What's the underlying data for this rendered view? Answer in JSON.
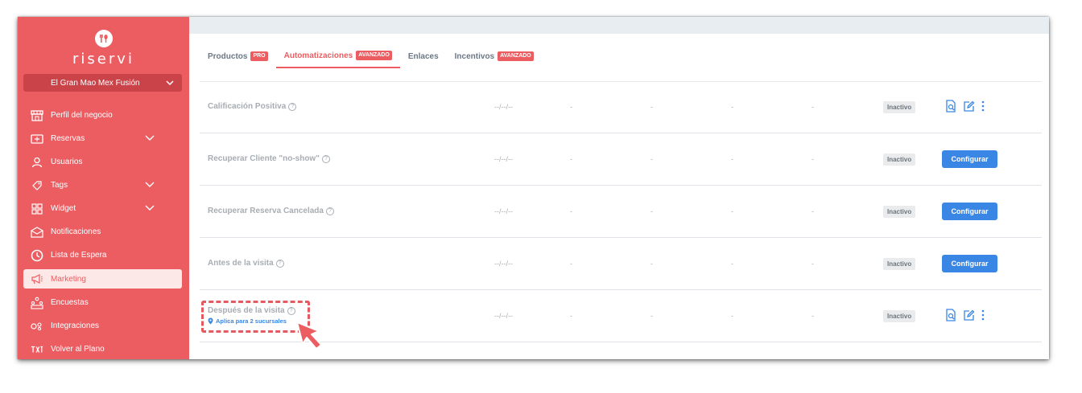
{
  "brand": {
    "name": "riservi",
    "accent": "#ec5d62",
    "button_blue": "#3a86e4"
  },
  "business": {
    "selected": "El Gran Mao Mex Fusión"
  },
  "sidebar": {
    "items": [
      {
        "label": "Perfil del negocio",
        "icon": "store-icon"
      },
      {
        "label": "Reservas",
        "icon": "ticket-icon",
        "expandable": true
      },
      {
        "label": "Usuarios",
        "icon": "user-icon"
      },
      {
        "label": "Tags",
        "icon": "tag-icon",
        "expandable": true
      },
      {
        "label": "Widget",
        "icon": "grid-icon",
        "expandable": true
      },
      {
        "label": "Notificaciones",
        "icon": "mail-icon"
      },
      {
        "label": "Lista de Espera",
        "icon": "clock-icon"
      },
      {
        "label": "Marketing",
        "icon": "megaphone-icon",
        "active": true
      },
      {
        "label": "Encuestas",
        "icon": "survey-icon"
      },
      {
        "label": "Integraciones",
        "icon": "integrations-icon"
      },
      {
        "label": "Volver al Plano",
        "icon": "floorplan-icon"
      }
    ]
  },
  "tabs": [
    {
      "label": "Productos",
      "badge": "PRO"
    },
    {
      "label": "Automatizaciones",
      "badge": "AVANZADO",
      "active": true
    },
    {
      "label": "Enlaces",
      "badge": ""
    },
    {
      "label": "Incentivos",
      "badge": "AVANZADO"
    }
  ],
  "automations": [
    {
      "name": "Calificación Positiva",
      "date": "--/--/--",
      "dashes": [
        "-",
        "-",
        "-",
        "-"
      ],
      "status": "Inactivo",
      "action": "icons"
    },
    {
      "name": "Recuperar Cliente \"no-show\"",
      "date": "--/--/--",
      "dashes": [
        "-",
        "-",
        "-",
        "-"
      ],
      "status": "Inactivo",
      "action": "button",
      "button_label": "Configurar"
    },
    {
      "name": "Recuperar Reserva Cancelada",
      "date": "--/--/--",
      "dashes": [
        "-",
        "-",
        "-",
        "-"
      ],
      "status": "Inactivo",
      "action": "button",
      "button_label": "Configurar"
    },
    {
      "name": "Antes de la visita",
      "date": "--/--/--",
      "dashes": [
        "-",
        "-",
        "-",
        "-"
      ],
      "status": "Inactivo",
      "action": "button",
      "button_label": "Configurar"
    },
    {
      "name": "Después de la visita",
      "sub": "Aplica para 2 sucursales",
      "date": "--/--/--",
      "dashes": [
        "-",
        "-",
        "-",
        "-"
      ],
      "status": "Inactivo",
      "action": "icons",
      "highlighted": true
    }
  ],
  "help_glyph": "?"
}
